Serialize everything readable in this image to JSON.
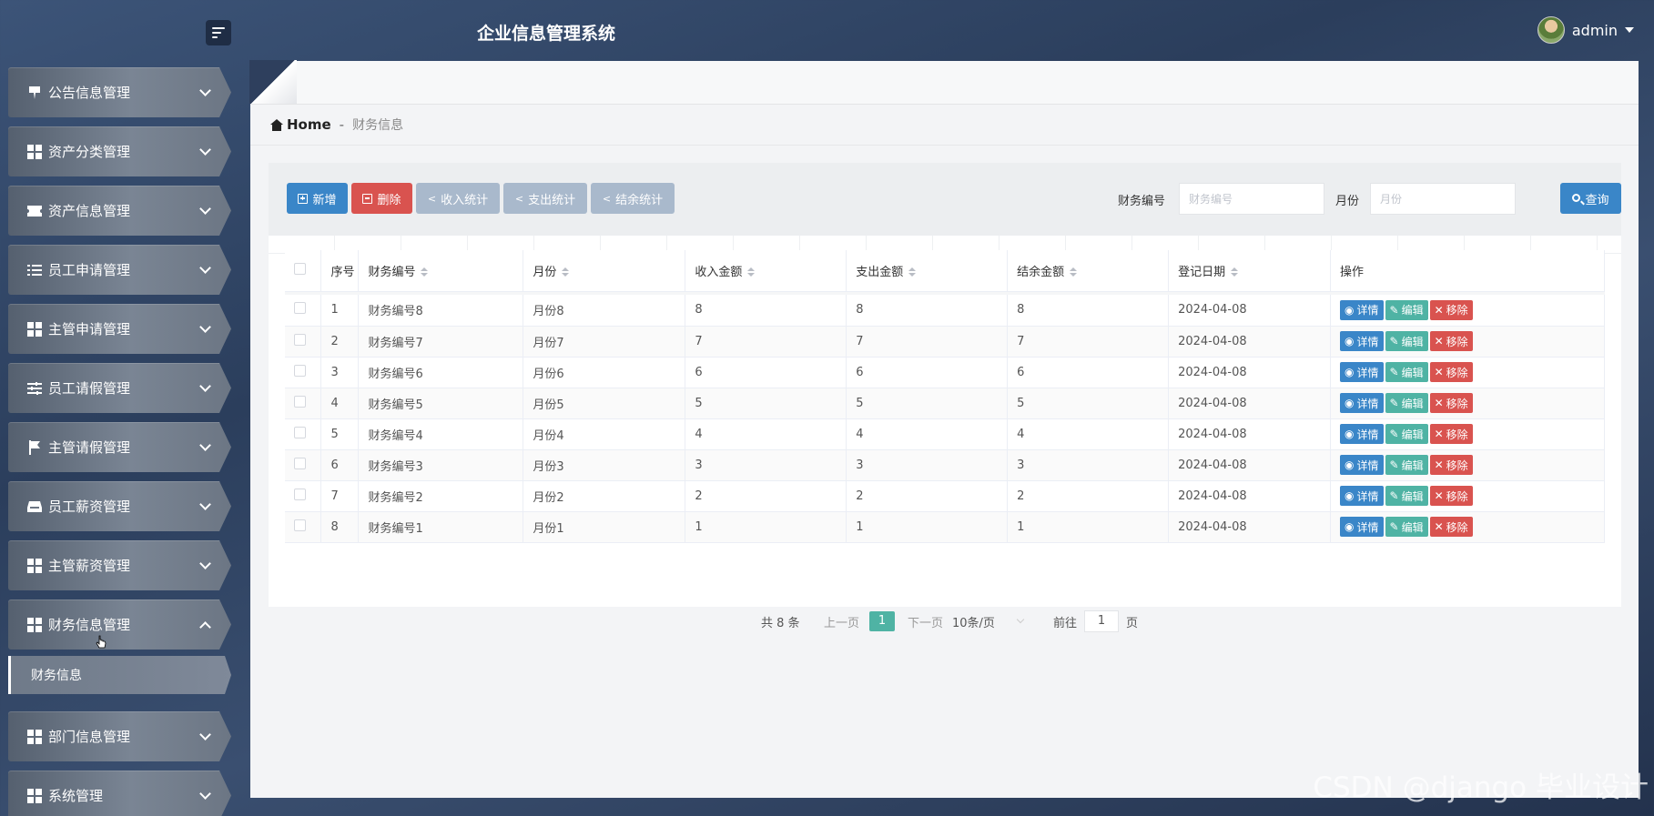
{
  "header": {
    "app_title": "企业信息管理系统",
    "user_name": "admin"
  },
  "sidebar": {
    "items": [
      {
        "label": "公告信息管理",
        "icon": "bookmark-icon"
      },
      {
        "label": "资产分类管理",
        "icon": "grid-icon"
      },
      {
        "label": "资产信息管理",
        "icon": "ticket-icon"
      },
      {
        "label": "员工申请管理",
        "icon": "list-icon"
      },
      {
        "label": "主管申请管理",
        "icon": "grid-icon"
      },
      {
        "label": "员工请假管理",
        "icon": "sliders-icon"
      },
      {
        "label": "主管请假管理",
        "icon": "flag-icon"
      },
      {
        "label": "员工薪资管理",
        "icon": "inbox-icon"
      },
      {
        "label": "主管薪资管理",
        "icon": "grid-icon"
      },
      {
        "label": "财务信息管理",
        "icon": "grid-icon",
        "expanded": true
      },
      {
        "label": "部门信息管理",
        "icon": "grid-icon"
      },
      {
        "label": "系统管理",
        "icon": "grid-icon"
      }
    ],
    "sub_item": "财务信息"
  },
  "breadcrumb": {
    "home": "Home",
    "separator": "-",
    "current": "财务信息"
  },
  "toolbar": {
    "add": "新增",
    "delete": "删除",
    "income_stats": "收入统计",
    "expense_stats": "支出统计",
    "balance_stats": "结余统计",
    "query": "查询",
    "filter_no_label": "财务编号",
    "filter_no_placeholder": "财务编号",
    "filter_month_label": "月份",
    "filter_month_placeholder": "月份"
  },
  "table": {
    "headers": {
      "index": "序号",
      "finance_no": "财务编号",
      "month": "月份",
      "income": "收入金额",
      "expense": "支出金额",
      "balance": "结余金额",
      "date": "登记日期",
      "actions": "操作"
    },
    "action_labels": {
      "view": "详情",
      "edit": "编辑",
      "remove": "移除"
    },
    "rows": [
      {
        "index": "1",
        "finance_no": "财务编号8",
        "month": "月份8",
        "income": "8",
        "expense": "8",
        "balance": "8",
        "date": "2024-04-08"
      },
      {
        "index": "2",
        "finance_no": "财务编号7",
        "month": "月份7",
        "income": "7",
        "expense": "7",
        "balance": "7",
        "date": "2024-04-08"
      },
      {
        "index": "3",
        "finance_no": "财务编号6",
        "month": "月份6",
        "income": "6",
        "expense": "6",
        "balance": "6",
        "date": "2024-04-08"
      },
      {
        "index": "4",
        "finance_no": "财务编号5",
        "month": "月份5",
        "income": "5",
        "expense": "5",
        "balance": "5",
        "date": "2024-04-08"
      },
      {
        "index": "5",
        "finance_no": "财务编号4",
        "month": "月份4",
        "income": "4",
        "expense": "4",
        "balance": "4",
        "date": "2024-04-08"
      },
      {
        "index": "6",
        "finance_no": "财务编号3",
        "month": "月份3",
        "income": "3",
        "expense": "3",
        "balance": "3",
        "date": "2024-04-08"
      },
      {
        "index": "7",
        "finance_no": "财务编号2",
        "month": "月份2",
        "income": "2",
        "expense": "2",
        "balance": "2",
        "date": "2024-04-08"
      },
      {
        "index": "8",
        "finance_no": "财务编号1",
        "month": "月份1",
        "income": "1",
        "expense": "1",
        "balance": "1",
        "date": "2024-04-08"
      }
    ]
  },
  "pagination": {
    "total": "共 8 条",
    "prev": "上一页",
    "current_page": "1",
    "next": "下一页",
    "page_size": "10条/页",
    "goto_prefix": "前往",
    "goto_value": "1",
    "goto_suffix": "页"
  },
  "watermark": "CSDN @django 毕业设计",
  "colors": {
    "primary": "#3a86c8",
    "danger": "#d9534f",
    "teal": "#4fb3a4",
    "muted_button": "#a9b9cc"
  }
}
